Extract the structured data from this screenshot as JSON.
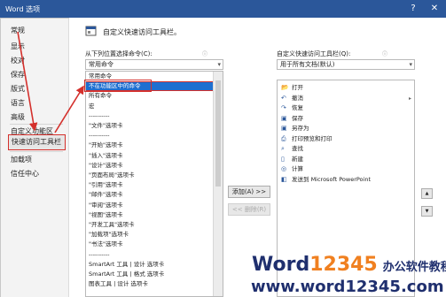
{
  "window": {
    "title": "Word 选项",
    "help": "?",
    "close": "✕"
  },
  "sidebar": {
    "items": [
      {
        "label": "常规"
      },
      {
        "label": "显示"
      },
      {
        "label": "校对"
      },
      {
        "label": "保存"
      },
      {
        "label": "版式"
      },
      {
        "label": "语言"
      },
      {
        "label": "高级"
      },
      {
        "label": "自定义功能区"
      },
      {
        "label": "快速访问工具栏"
      },
      {
        "label": "加载项"
      },
      {
        "label": "信任中心"
      }
    ]
  },
  "main": {
    "heading": "自定义快速访问工具栏。",
    "choose_label": "从下列位置选择命令(C):",
    "choose_value": "常用命令",
    "customize_label": "自定义快速访问工具栏(Q):",
    "customize_value": "用于所有文档(默认)",
    "commands": [
      "常用命令",
      "不在功能区中的命令",
      "所有命令",
      "宏",
      "----------",
      "\"文件\"选项卡",
      "----------",
      "\"开始\"选项卡",
      "\"插入\"选项卡",
      "\"设计\"选项卡",
      "\"页面布局\"选项卡",
      "\"引用\"选项卡",
      "\"邮件\"选项卡",
      "\"审阅\"选项卡",
      "\"视图\"选项卡",
      "\"开发工具\"选项卡",
      "\"加载项\"选项卡",
      "\"书法\"选项卡",
      "----------",
      "SmartArt 工具 | 设计 选项卡",
      "SmartArt 工具 | 格式 选项卡",
      "图表工具 | 设计 选项卡"
    ],
    "selected_index": 1,
    "toolbar_items": [
      {
        "label": "打开",
        "icon": "folder-icon"
      },
      {
        "label": "撤消",
        "icon": "undo-icon"
      },
      {
        "label": "恢复",
        "icon": "redo-icon"
      },
      {
        "label": "保存",
        "icon": "save-icon"
      },
      {
        "label": "另存为",
        "icon": "save-as-icon"
      },
      {
        "label": "打印预览和打印",
        "icon": "print-preview-icon"
      },
      {
        "label": "查找",
        "icon": "find-icon"
      },
      {
        "label": "新建",
        "icon": "new-document-icon"
      },
      {
        "label": "计算",
        "icon": "calculate-icon"
      },
      {
        "label": "发送到 Microsoft PowerPoint",
        "icon": "powerpoint-icon"
      }
    ],
    "add_button": "添加(A) >>",
    "remove_button": "<< 删除(R)"
  },
  "watermark": {
    "line1_prefix": "Word",
    "line1_num": "12345",
    "line1_cn": "办公软件教程",
    "line2": "www.word12345.com"
  },
  "colors": {
    "accent": "#2b579a",
    "highlight": "#d4302c",
    "selection": "#1e6fd0"
  }
}
